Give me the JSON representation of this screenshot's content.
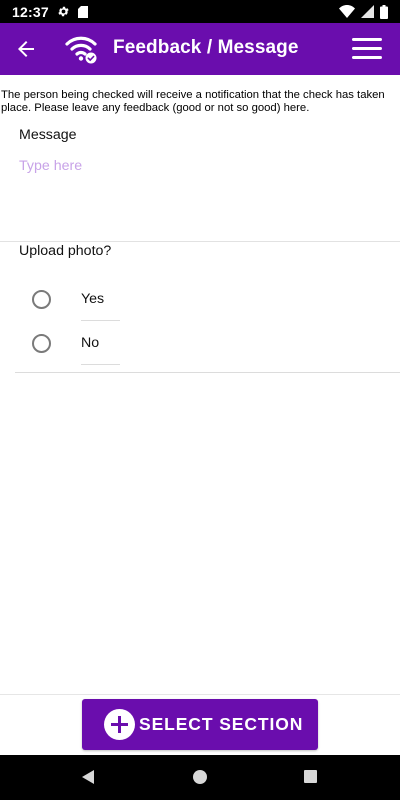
{
  "status_bar": {
    "time": "12:37",
    "left_icons": [
      "gear-icon",
      "sd-card-icon"
    ],
    "right_icons": [
      "wifi-signal-icon",
      "cell-signal-icon",
      "battery-icon"
    ]
  },
  "app_bar": {
    "title": "Feedback / Message",
    "back_icon": "arrow-left-icon",
    "logo_icon": "wifi-check-icon",
    "menu_icon": "hamburger-menu-icon"
  },
  "intro_text": "The person being checked will receive a notification that the check has taken place. Please leave any feedback (good or not so good) here.",
  "message": {
    "label": "Message",
    "placeholder": "Type here",
    "value": ""
  },
  "upload": {
    "label": "Upload photo?",
    "options": [
      {
        "label": "Yes",
        "selected": false
      },
      {
        "label": "No",
        "selected": false
      }
    ]
  },
  "action_button": {
    "label": "SELECT SECTION",
    "icon": "plus-circle-icon"
  },
  "nav_bar": {
    "icons": [
      "nav-back-icon",
      "nav-home-icon",
      "nav-recent-icon"
    ]
  },
  "colors": {
    "primary": "#6a0dad",
    "placeholder": "#c8a3e8",
    "status_bar": "#000000"
  }
}
